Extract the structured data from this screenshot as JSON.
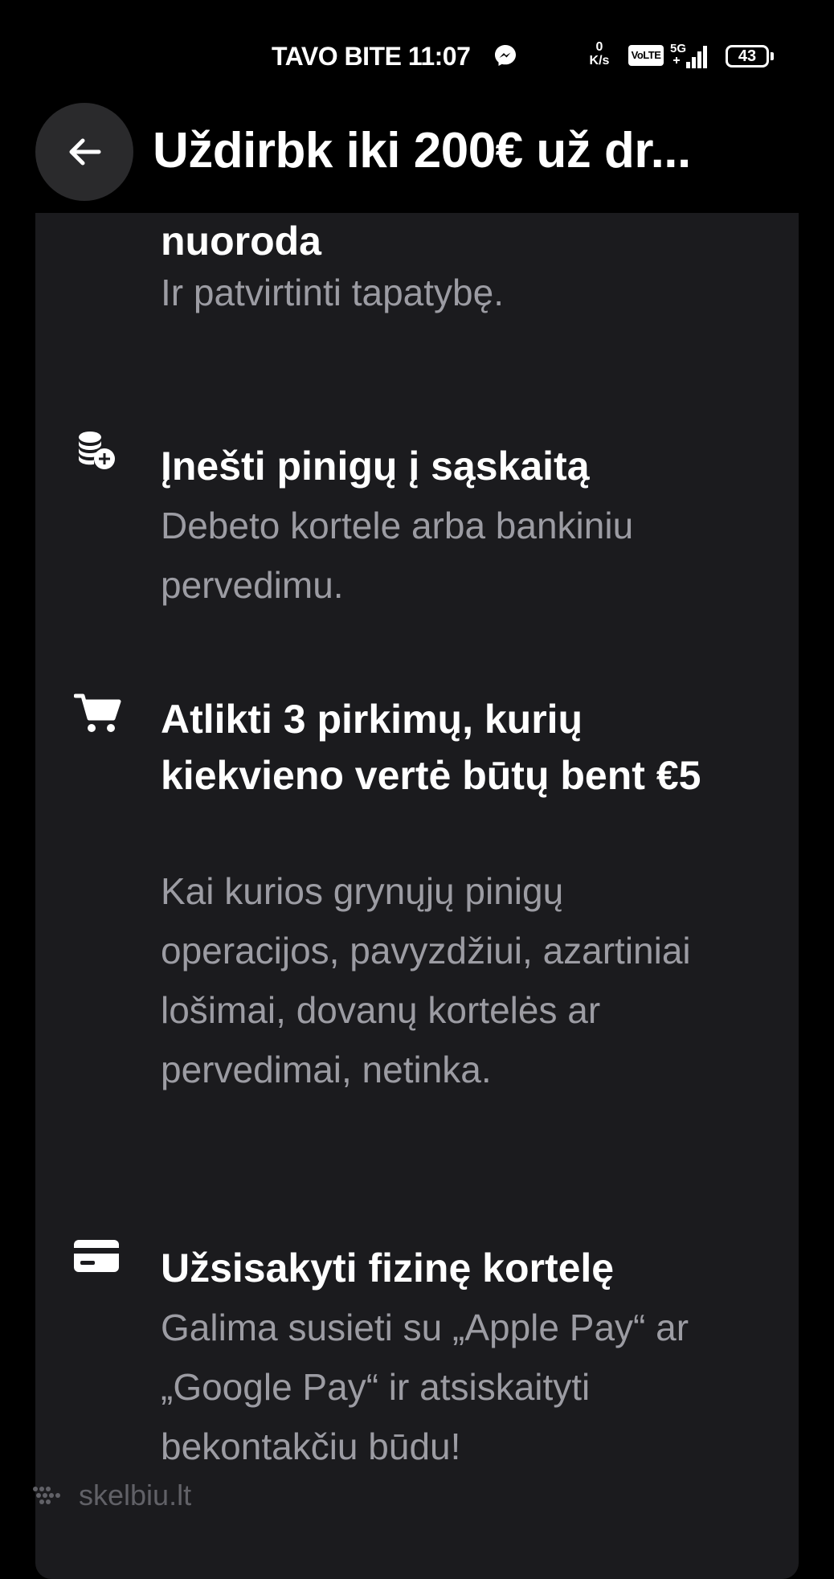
{
  "status_bar": {
    "carrier_time": "TAVO BITE 11:07",
    "net_speed_value": "0",
    "net_speed_unit": "K/s",
    "volte": "VoLTE",
    "network": "5G",
    "battery": "43"
  },
  "header": {
    "title": "Uždirbk iki 200€ už dr..."
  },
  "steps": [
    {
      "icon": "user-icon",
      "title": "Užsiregistruoti su tavo nuoroda",
      "description": "Ir patvirtinti tapatybę."
    },
    {
      "icon": "coins-plus-icon",
      "title": "Įnešti pinigų į sąskaitą",
      "description": "Debeto kortele arba bankiniu pervedimu."
    },
    {
      "icon": "shopping-cart-icon",
      "title": "Atlikti 3 pirkimų, kurių kiekvieno vertė būtų bent €5",
      "description": "Kai kurios grynųjų pinigų operacijos, pavyzdžiui, azartiniai lošimai, dovanų kortelės ar pervedimai, netinka."
    },
    {
      "icon": "credit-card-icon",
      "title": "Užsisakyti fizinę kortelę",
      "description": "Galima susieti su „Apple Pay“ ar „Google Pay“ ir atsiskaityti bekontakčiu būdu!"
    }
  ],
  "watermark": "skelbiu.lt"
}
